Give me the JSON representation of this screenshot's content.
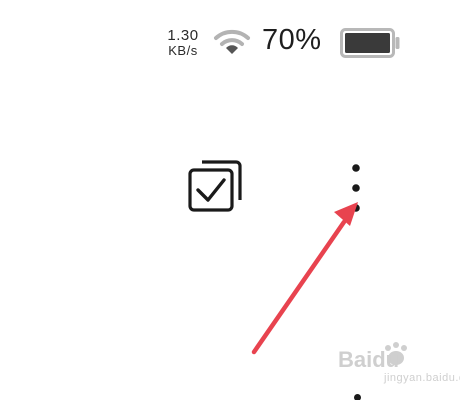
{
  "status_bar": {
    "net_speed_value": "1.30",
    "net_speed_unit": "KB/s",
    "battery_percent": "70%",
    "battery_level": 0.7,
    "wifi_icon": "wifi-icon",
    "battery_icon": "battery-icon"
  },
  "toolbar": {
    "multi_select_icon": "multi-select-checkbox-icon",
    "more_icon": "more-vertical-icon"
  },
  "annotation": {
    "arrow_color": "#e8434f",
    "arrow_target": "more-vertical-icon"
  },
  "watermark": {
    "brand": "Baidu",
    "sub": "jingyan.baidu.com"
  },
  "colors": {
    "icon": "#1a1a1a",
    "status_gray": "#b3b3b3",
    "battery_fill": "#3a3a3a",
    "annotation_red": "#e8434f",
    "watermark": "#c9c9c9"
  }
}
